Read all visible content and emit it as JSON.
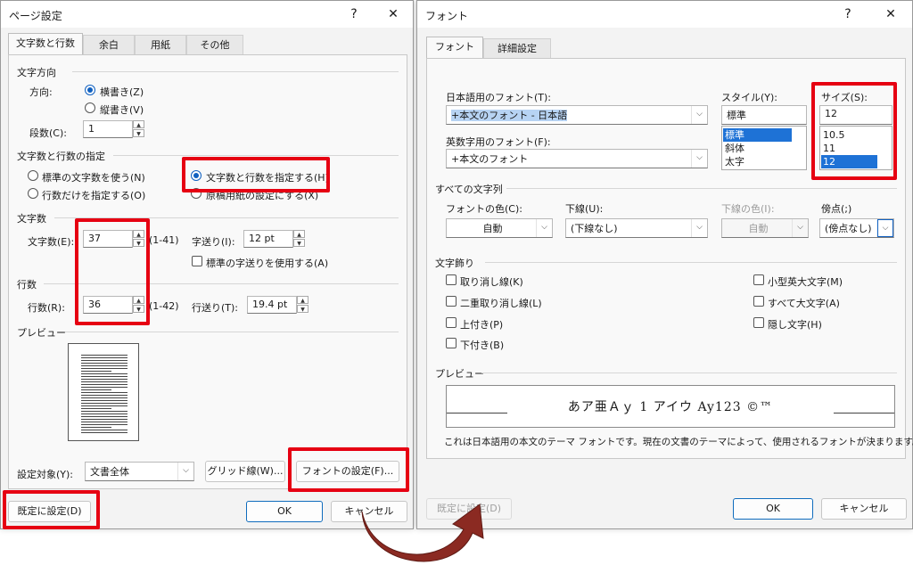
{
  "left_dialog": {
    "title": "ページ設定",
    "help": "?",
    "close": "✕",
    "tabs": [
      "文字数と行数",
      "余白",
      "用紙",
      "その他"
    ],
    "direction": {
      "section": "文字方向",
      "label": "方向:",
      "horizontal": "横書き(Z)",
      "vertical": "縦書き(V)",
      "columns_label": "段数(C):",
      "columns_value": "1"
    },
    "grid": {
      "section": "文字数と行数の指定",
      "opt_standard": "標準の文字数を使う(N)",
      "opt_chars_lines": "文字数と行数を指定する(H)",
      "opt_lines_only": "行数だけを指定する(O)",
      "opt_manuscript": "原稿用紙の設定にする(X)"
    },
    "chars": {
      "section": "文字数",
      "label": "文字数(E):",
      "value": "37",
      "range": "(1-41)",
      "pitch_label": "字送り(I):",
      "pitch_value": "12 pt",
      "use_standard": "標準の字送りを使用する(A)"
    },
    "lines": {
      "section": "行数",
      "label": "行数(R):",
      "value": "36",
      "range": "(1-42)",
      "pitch_label": "行送り(T):",
      "pitch_value": "19.4 pt"
    },
    "preview": {
      "section": "プレビュー"
    },
    "apply_label": "設定対象(Y):",
    "apply_value": "文書全体",
    "grid_button": "グリッド線(W)...",
    "font_button": "フォントの設定(F)...",
    "default_button": "既定に設定(D)",
    "ok": "OK",
    "cancel": "キャンセル"
  },
  "right_dialog": {
    "title": "フォント",
    "help": "?",
    "close": "✕",
    "tabs": [
      "フォント",
      "詳細設定"
    ],
    "jp_font_label": "日本語用のフォント(T):",
    "jp_font_value": "+本文のフォント - 日本語",
    "en_font_label": "英数字用のフォント(F):",
    "en_font_value": "+本文のフォント",
    "style_label": "スタイル(Y):",
    "style_value": "標準",
    "style_options": [
      "標準",
      "斜体",
      "太字"
    ],
    "size_label": "サイズ(S):",
    "size_value": "12",
    "size_options": [
      "10.5",
      "11",
      "12"
    ],
    "all_text_section": "すべての文字列",
    "font_color_label": "フォントの色(C):",
    "font_color_value": "自動",
    "underline_label": "下線(U):",
    "underline_value": "(下線なし)",
    "underline_color_label": "下線の色(I):",
    "underline_color_value": "自動",
    "emphasis_label": "傍点(;)",
    "emphasis_value": "(傍点なし)",
    "effects_section": "文字飾り",
    "effects_left": [
      "取り消し線(K)",
      "二重取り消し線(L)",
      "上付き(P)",
      "下付き(B)"
    ],
    "effects_right": [
      "小型英大文字(M)",
      "すべて大文字(A)",
      "隠し文字(H)"
    ],
    "preview_section": "プレビュー",
    "preview_sample": "あア亜Ａｙ 1 アイウ Ay123 ©™",
    "preview_note": "これは日本語用の本文のテーマ フォントです。現在の文書のテーマによって、使用されるフォントが決まります。",
    "default_button": "既定に設定(D)",
    "ok": "OK",
    "cancel": "キャンセル"
  },
  "colors": {
    "highlight": "#e60012",
    "arrow": "#8b2a22",
    "accent": "#1060c0"
  }
}
